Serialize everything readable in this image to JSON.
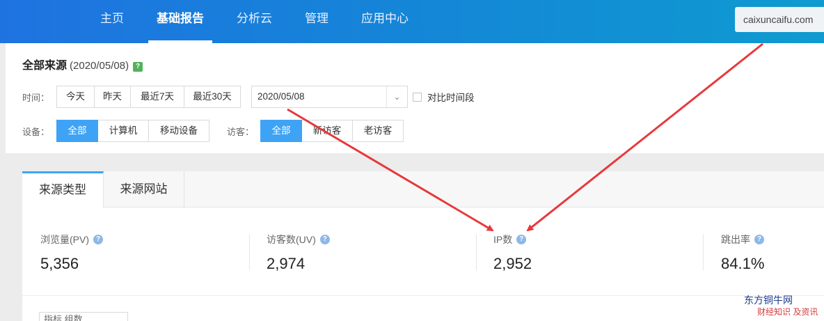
{
  "nav": {
    "items": [
      {
        "label": "主页",
        "active": false
      },
      {
        "label": "基础报告",
        "active": true
      },
      {
        "label": "分析云",
        "active": false
      },
      {
        "label": "管理",
        "active": false
      },
      {
        "label": "应用中心",
        "active": false
      }
    ],
    "domain": "caixuncaifu.com"
  },
  "filter": {
    "title": "全部来源",
    "date": "(2020/05/08)",
    "help_icon": "?",
    "time_label": "时间：",
    "time_options": [
      "今天",
      "昨天",
      "最近7天",
      "最近30天"
    ],
    "date_value": "2020/05/08",
    "compare_label": "对比时间段",
    "device_label": "设备：",
    "device_options": [
      "全部",
      "计算机",
      "移动设备"
    ],
    "device_selected": "全部",
    "visitor_label": "访客：",
    "visitor_options": [
      "全部",
      "新访客",
      "老访客"
    ],
    "visitor_selected": "全部"
  },
  "tabs": [
    "来源类型",
    "来源网站"
  ],
  "metrics": [
    {
      "label": "浏览量(PV)",
      "value": "5,356"
    },
    {
      "label": "访客数(UV)",
      "value": "2,974"
    },
    {
      "label": "IP数",
      "value": "2,952"
    },
    {
      "label": "跳出率",
      "value": "84.1%"
    }
  ],
  "partial": "指标    组数",
  "watermark": {
    "line1": "东方铜牛网",
    "line2": "财经知识 及资讯"
  },
  "colors": {
    "accent": "#3fa3f5",
    "nav": "#1f73e0",
    "arrow": "#e8383b"
  }
}
